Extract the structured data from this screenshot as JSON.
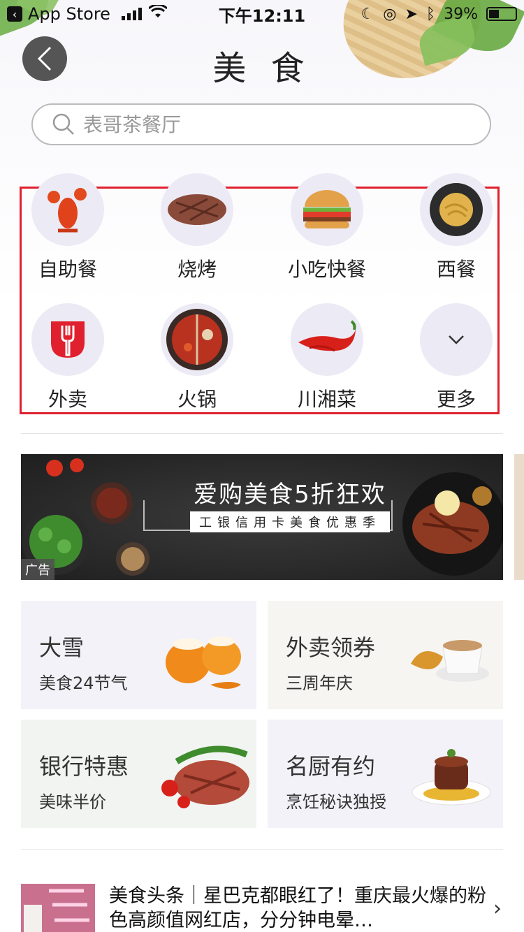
{
  "status_bar": {
    "back_app": "App Store",
    "time": "下午12:11",
    "battery": "39%"
  },
  "header": {
    "title": "美 食"
  },
  "search": {
    "placeholder": "表哥茶餐厅"
  },
  "categories": [
    {
      "label": "自助餐",
      "icon": "lobster-icon"
    },
    {
      "label": "烧烤",
      "icon": "grilled-steak-icon"
    },
    {
      "label": "小吃快餐",
      "icon": "burger-icon"
    },
    {
      "label": "西餐",
      "icon": "pasta-icon"
    },
    {
      "label": "外卖",
      "icon": "takeout-fork-icon"
    },
    {
      "label": "火锅",
      "icon": "hotpot-icon"
    },
    {
      "label": "川湘菜",
      "icon": "chili-icon"
    },
    {
      "label": "更多",
      "icon": "chevron-down-icon"
    }
  ],
  "banner": {
    "title": "爱购美食5折狂欢",
    "subtitle": "工银信用卡美食优惠季",
    "ad_label": "广告"
  },
  "promos": [
    {
      "title": "大雪",
      "subtitle": "美食24节气",
      "bg": "#f3f2f8"
    },
    {
      "title": "外卖领券",
      "subtitle": "三周年庆",
      "bg": "#f6f5f1"
    },
    {
      "title": "银行特惠",
      "subtitle": "美味半价",
      "bg": "#f1f4f1"
    },
    {
      "title": "名厨有约",
      "subtitle": "烹饪秘诀独授",
      "bg": "#f3f2f8"
    }
  ],
  "news": {
    "text": "美食头条｜星巴克都眼红了！重庆最火爆的粉色高颜值网红店，分分钟电晕…"
  },
  "colors": {
    "highlight_box": "#e0202e",
    "category_circle": "#eceaf4",
    "back_button": "#555555"
  }
}
